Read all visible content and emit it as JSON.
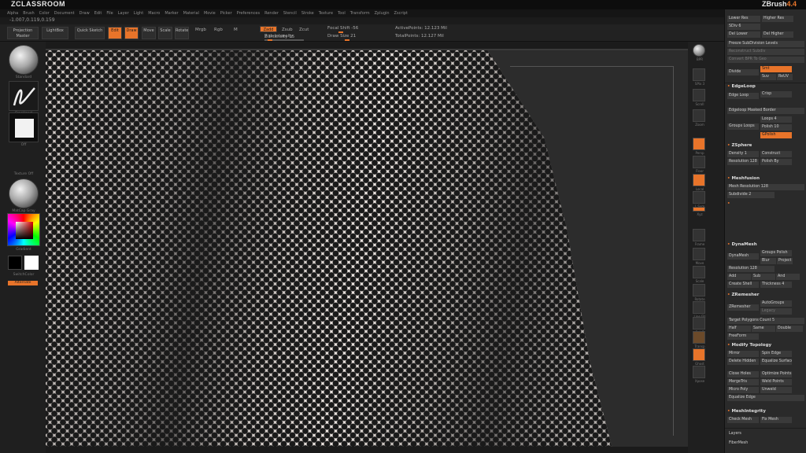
{
  "app": {
    "left_brand": "ZCLASSROOM",
    "right_brand": "ZBrush",
    "right_version": "4.4"
  },
  "menubar": [
    "Alpha",
    "Brush",
    "Color",
    "Document",
    "Draw",
    "Edit",
    "File",
    "Layer",
    "Light",
    "Macro",
    "Marker",
    "Material",
    "Movie",
    "Picker",
    "Preferences",
    "Render",
    "Stencil",
    "Stroke",
    "Texture",
    "Tool",
    "Transform",
    "Zplugin",
    "Zscript"
  ],
  "coords": "-1.007,0.119,0.159",
  "toolbar": {
    "projection_master": "Projection Master",
    "lightbox": "LightBox",
    "quick_sketch": "Quick Sketch",
    "edit": "Edit",
    "draw": "Draw",
    "move": "Move",
    "scale": "Scale",
    "rotate": "Rotate",
    "mrgb": "Mrgb",
    "rgb": "Rgb",
    "m": "M",
    "zadd": "Zadd",
    "zsub": "Zsub",
    "zcut": "Zcut",
    "rgb_intensity": "Rgb Intensity",
    "z_intensity": "Z Intensity 15",
    "focal_shift": "Focal Shift -56",
    "draw_size": "Draw Size 21",
    "active_points": "ActivePoints: 12.123 Mil",
    "total_points": "TotalPoints: 12.127 Mil"
  },
  "left_shelf": {
    "brush_label": "Standard",
    "stroke_label": "FreeHand",
    "alpha_label": "Off",
    "texture_label": "Texture Off",
    "material_label": "MatCap Gray",
    "gradient_label": "Gradient",
    "switch_color_label": "SwitchColor",
    "alternate_label": "Alternate"
  },
  "right_shelf": [
    "BPR",
    "SPix 3",
    "Scroll",
    "Zoom",
    "Actual",
    "AAHalf",
    "Persp",
    "Floor",
    "Local",
    "L.Sym",
    "Xyz",
    "Frame",
    "Move",
    "Scale",
    "Rotate",
    "Line Fill",
    "PolyF",
    "Transp",
    "Ghost",
    "Solo",
    "Xpose"
  ],
  "subtool_panel": {
    "top_buttons": [
      "Lower Res",
      "Higher Res",
      "SDiv 6",
      "Del Lower",
      "Del Higher",
      "Freeze SubDivision Levels",
      "Reconstruct Subdiv",
      "Convert BPR To Geo"
    ],
    "divide_label": "Divide",
    "smt_label": "Smt",
    "suv_label": "Suv",
    "rsuv_label": "ReUV",
    "edgeloop_head": "EdgeLoop",
    "edgeloop_buttons": [
      "Edge Loop",
      "Crisp",
      "Edgeloop Masked Border",
      "Groups Loops",
      "Loops 4",
      "Polish 10"
    ],
    "append_label": "GPolish",
    "zsphere_head": "ZSphere",
    "zsphere_buttons": [
      "Density 1",
      "Construct",
      "Resolution 128",
      "Polish By"
    ],
    "multimap_head": "Meshfusion",
    "meshfusion_buttons": [
      "Mesh Resolution 128",
      "Subdivide 2"
    ],
    "dynamesh_head": "DynaMesh",
    "dynamesh_buttons": [
      "DynaMesh",
      "Groups Polish",
      "Blur",
      "Project",
      "Resolution 128",
      "Add",
      "Sub",
      "And",
      "Create Shell",
      "Thickness 4"
    ],
    "zremesher_head": "ZRemesher",
    "zremesher_buttons": [
      "ZRemesher",
      "AutoGroups",
      "Legacy",
      "Target Polygons Count 5",
      "Half",
      "Same",
      "Double",
      "FreeForm"
    ],
    "modify_head": "Modify Topology",
    "modify_buttons": [
      "Mirror",
      "Spin Edge",
      "Delete Hidden",
      "Equalize Surface Area",
      "Close Holes",
      "Optimize Points",
      "MergeTris",
      "Weld Points",
      "Micro Poly",
      "Unweld",
      "Equalize Edge"
    ],
    "mesh_integrity_head": "MeshIntegrity",
    "mesh_integrity_buttons": [
      "Check Mesh",
      "Fix Mesh"
    ],
    "layers_label": "Layers",
    "fibermesh_label": "FiberMesh"
  },
  "colors": {
    "accent": "#e8742a",
    "panel": "#2a2a2a",
    "background": "#1b1b1b"
  }
}
